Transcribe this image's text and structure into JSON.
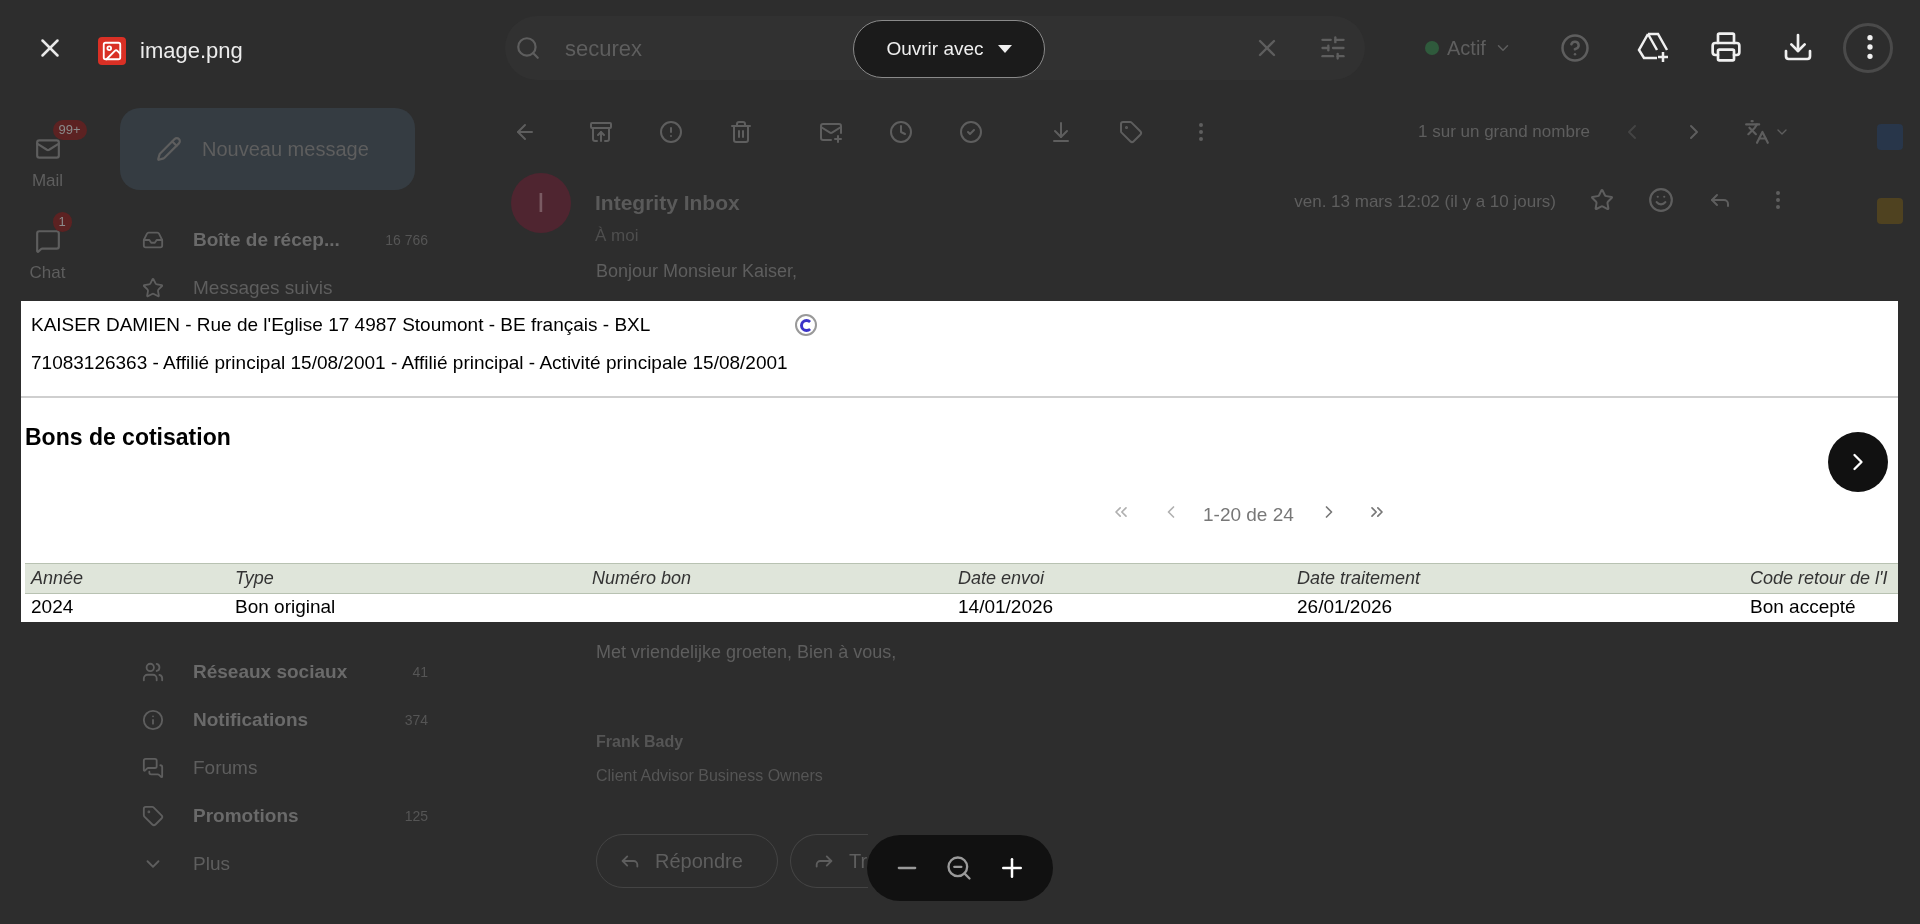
{
  "viewer": {
    "file_name": "image.png",
    "open_with": "Ouvrir avec"
  },
  "gmail": {
    "search": {
      "value": "securex"
    },
    "status": "Actif",
    "rail": [
      {
        "label": "Mail",
        "badge": "99+"
      },
      {
        "label": "Chat",
        "badge": "1"
      }
    ],
    "compose": "Nouveau message",
    "folders": [
      {
        "label": "Boîte de récep...",
        "count": "16 766",
        "unread": true
      },
      {
        "label": "Messages suivis",
        "unread": false
      }
    ],
    "folders_lower": [
      {
        "label": "Réseaux sociaux",
        "count": "41",
        "unread": true
      },
      {
        "label": "Notifications",
        "count": "374",
        "unread": true
      },
      {
        "label": "Forums",
        "unread": false
      },
      {
        "label": "Promotions",
        "count": "125",
        "unread": true
      },
      {
        "label": "Plus",
        "unread": false
      }
    ],
    "pager": "1 sur un grand nombre",
    "email": {
      "sender": "Integrity Inbox",
      "initial": "I",
      "recipient": "À moi",
      "date": "ven. 13 mars 12:02 (il y a 10 jours)",
      "greeting": "Bonjour Monsieur Kaiser,",
      "closing": "Met vriendelijke groeten, Bien à vous,",
      "signature_name": "Frank Bady",
      "signature_title": "Client Advisor Business Owners"
    },
    "reply_buttons": [
      "Répondre",
      "Tr"
    ]
  },
  "document": {
    "lines": [
      "KAISER DAMIEN - Rue de l'Eglise 17 4987 Stoumont - BE français - BXL",
      "71083126363 - Affilié principal 15/08/2001 - Affilié principal - Activité principale 15/08/2001"
    ],
    "title": "Bons de cotisation",
    "pagination": "1-20 de 24",
    "columns": [
      "Année",
      "Type",
      "Numéro bon",
      "Date envoi",
      "Date traitement",
      "Code retour de l'I"
    ],
    "rows": [
      {
        "cells": [
          "2024",
          "Bon original",
          null,
          "14/01/2026",
          "26/01/2026",
          "Bon accepté"
        ]
      }
    ]
  }
}
